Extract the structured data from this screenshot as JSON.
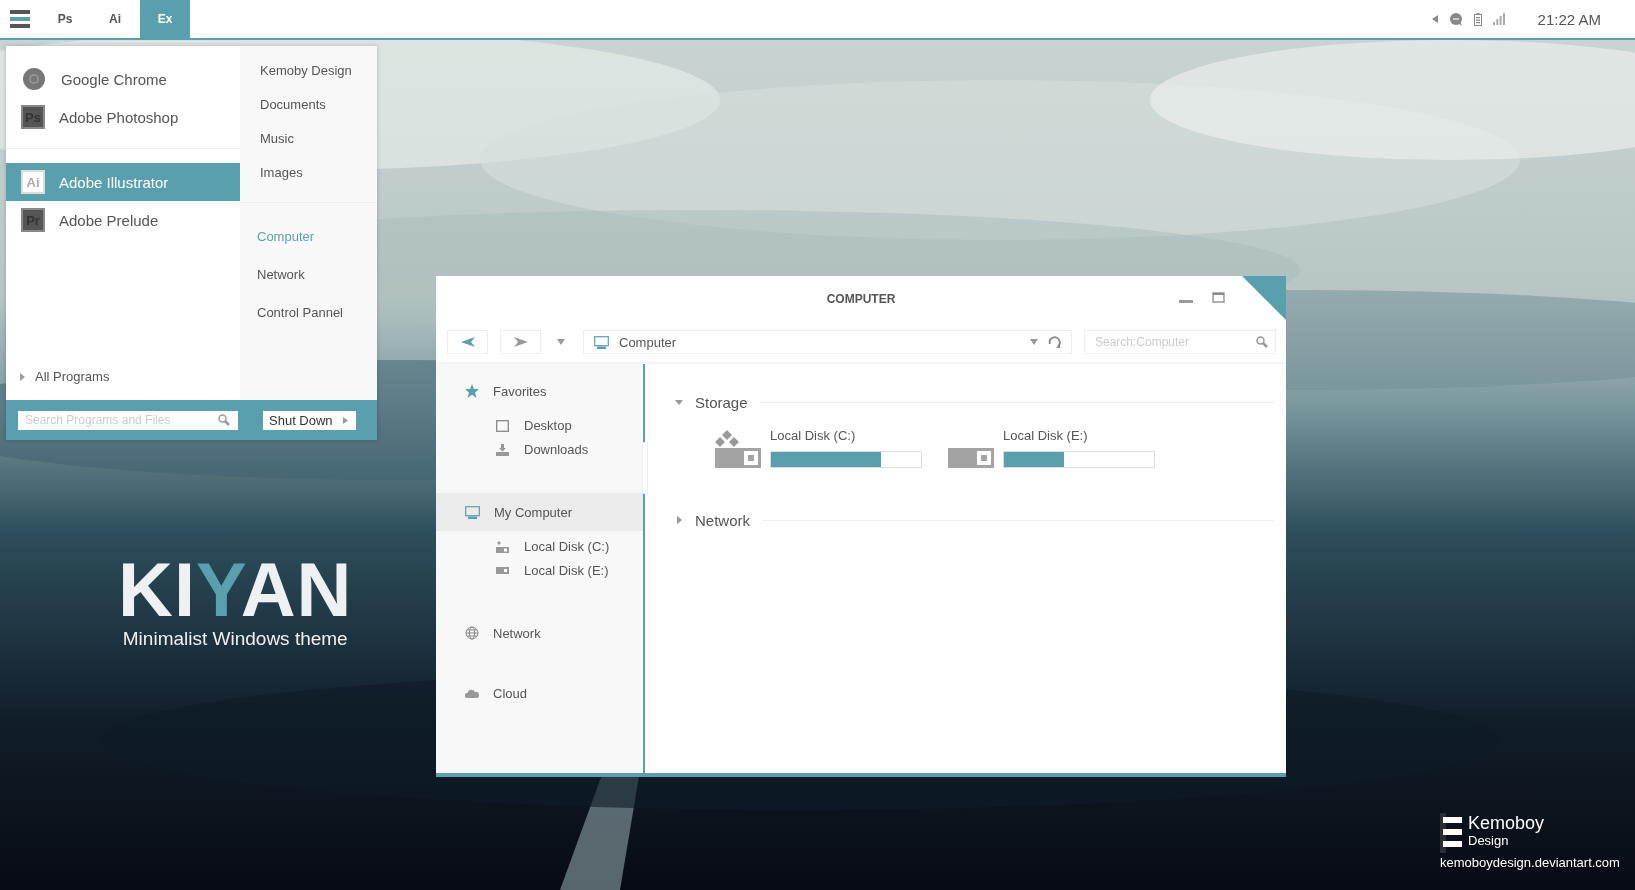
{
  "taskbar": {
    "tabs": [
      {
        "label": "Ps",
        "selected": false
      },
      {
        "label": "Ai",
        "selected": false
      },
      {
        "label": "Ex",
        "selected": true
      }
    ],
    "clock": "21:22 AM"
  },
  "start_menu": {
    "pinned": [
      {
        "name": "Google Chrome",
        "kind": "circle",
        "selected": false
      },
      {
        "name": "Adobe Photoshop",
        "kind": "badge",
        "badge": "Ps",
        "selected": false
      }
    ],
    "recent": [
      {
        "name": "Adobe Illustrator",
        "kind": "badge",
        "badge": "Ai",
        "selected": true
      },
      {
        "name": "Adobe Prelude",
        "kind": "badge",
        "badge": "Pr",
        "selected": false
      }
    ],
    "all_programs": "All Programs",
    "places": [
      {
        "label": "Kemoby Design",
        "selected": false
      },
      {
        "label": "Documents",
        "selected": false
      },
      {
        "label": "Music",
        "selected": false
      },
      {
        "label": "Images",
        "selected": false
      }
    ],
    "system_places": [
      {
        "label": "Computer",
        "selected": true
      },
      {
        "label": "Network",
        "selected": false
      },
      {
        "label": "Control Pannel",
        "selected": false
      }
    ],
    "search": {
      "placeholder": "Search Programs and Files"
    },
    "shutdown": "Shut Down"
  },
  "branding": {
    "logo": [
      {
        "text": "KI",
        "color": "#eef0f1"
      },
      {
        "text": "Y",
        "color": "#5a9fae"
      },
      {
        "text": "AN",
        "color": "#eef0f1"
      }
    ],
    "tagline": "Minimalist Windows theme"
  },
  "explorer": {
    "title": "COMPUTER",
    "address": "Computer",
    "search": {
      "placeholder": "Search:Computer"
    },
    "sidebar": [
      {
        "label": "Favorites",
        "kind": "star",
        "selected": false,
        "children": [
          {
            "label": "Desktop",
            "kind": "square"
          },
          {
            "label": "Downloads",
            "kind": "download"
          }
        ]
      },
      {
        "label": "My Computer",
        "kind": "monitor",
        "selected": true,
        "children": [
          {
            "label": "Local Disk (C:)",
            "kind": "system-drive"
          },
          {
            "label": "Local Disk (E:)",
            "kind": "drive"
          }
        ]
      },
      {
        "label": "Network",
        "kind": "globe",
        "selected": false
      },
      {
        "label": "Cloud",
        "kind": "cloud",
        "selected": false
      }
    ],
    "sections": [
      {
        "title": "Storage",
        "expanded": true,
        "drives": [
          {
            "name": "Local Disk (C:)",
            "kind": "system-drive",
            "level": 0.73
          },
          {
            "name": "Local Disk (E:)",
            "kind": "drive",
            "level": 0.4
          }
        ]
      },
      {
        "title": "Network",
        "expanded": false
      }
    ]
  },
  "credit": {
    "name": "Kemoboy",
    "sub": "Design",
    "url": "kemoboydesign.deviantart.com"
  }
}
